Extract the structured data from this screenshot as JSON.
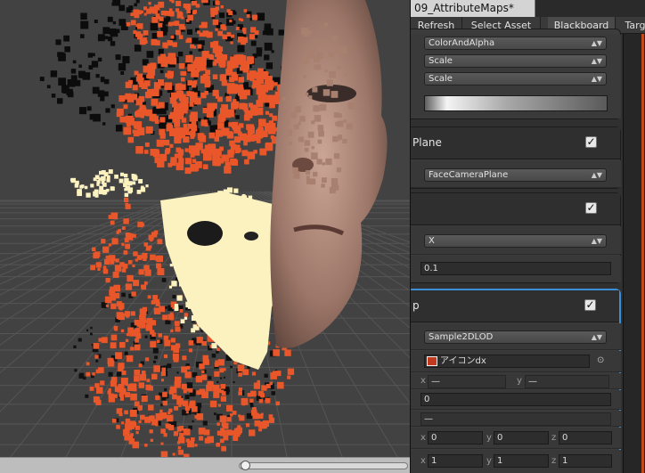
{
  "window": {
    "title": "09_AttributeMaps*"
  },
  "toolbar": {
    "buttons": [
      "Refresh",
      "Select Asset",
      "Blackboard",
      "Targ"
    ]
  },
  "nodes": {
    "color": {
      "dropdowns": [
        "ColorAndAlpha",
        "Scale",
        "Scale"
      ]
    },
    "orient": {
      "title": "Plane",
      "checked": "✓",
      "mode": "FaceCameraPlane"
    },
    "size": {
      "checked": "✓",
      "axis": "X",
      "value": "0.1"
    },
    "attribute_map": {
      "title": "p",
      "checked": "✓",
      "sample_mode": "Sample2DLOD",
      "texture_name": "アイコンdx",
      "uv_x_label": "x",
      "uv_x_value": "—",
      "uv_y_label": "y",
      "uv_y_value": "—",
      "mip_value": "0",
      "mip2_value": "—",
      "offset": {
        "x": "0",
        "y": "0",
        "z": "0"
      },
      "scale": {
        "x": "1",
        "y": "1",
        "z": "1"
      }
    }
  },
  "colors": {
    "accent_orange": "#e8562a",
    "accent_cream": "#fbf2c0",
    "selection_blue": "#3a8fd6"
  },
  "icons": {
    "checkbox": "check-icon",
    "dropdown": "chevron-updown-icon",
    "texture": "texture-thumbnail-icon",
    "object_picker": "target-icon"
  }
}
